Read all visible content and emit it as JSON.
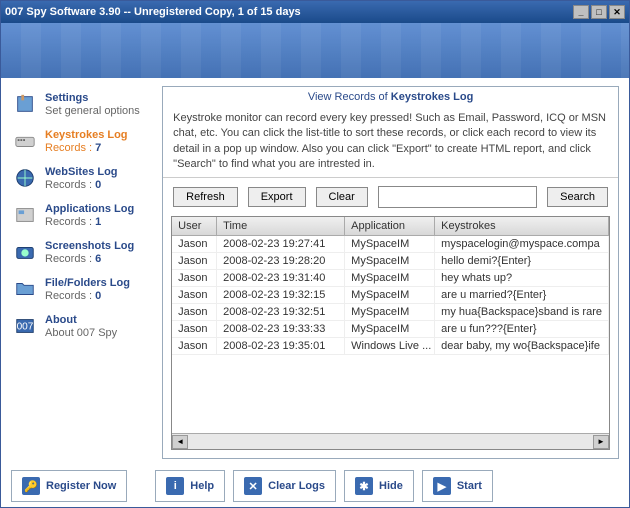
{
  "window": {
    "title": "007 Spy Software 3.90 -- Unregistered Copy, 1 of 15 days"
  },
  "sidebar": {
    "items": [
      {
        "title": "Settings",
        "sub": "Set general options",
        "records": ""
      },
      {
        "title": "Keystrokes Log",
        "sub_prefix": "Records : ",
        "records": "7",
        "active": true
      },
      {
        "title": "WebSites Log",
        "sub_prefix": "Records : ",
        "records": "0"
      },
      {
        "title": "Applications Log",
        "sub_prefix": "Records : ",
        "records": "1"
      },
      {
        "title": "Screenshots Log",
        "sub_prefix": "Records : ",
        "records": "6"
      },
      {
        "title": "File/Folders Log",
        "sub_prefix": "Records : ",
        "records": "0"
      },
      {
        "title": "About",
        "sub": "About 007 Spy",
        "records": ""
      }
    ]
  },
  "panel": {
    "title_prefix": "View Records of ",
    "title_subject": "Keystrokes Log",
    "description": "Keystroke monitor can record every key pressed! Such as Email, Password, ICQ or MSN chat, etc. You can click the list-title to sort these records, or click each record to view its detail in a pop up window. Also you can click \"Export\" to create HTML report, and click \"Search\" to find what you are intrested in.",
    "buttons": {
      "refresh": "Refresh",
      "export": "Export",
      "clear": "Clear",
      "search": "Search"
    },
    "search_value": "",
    "columns": {
      "user": "User",
      "time": "Time",
      "app": "Application",
      "keys": "Keystrokes"
    },
    "rows": [
      {
        "user": "Jason",
        "time": "2008-02-23 19:27:41",
        "app": "MySpaceIM",
        "keys": "myspacelogin@myspace.compa"
      },
      {
        "user": "Jason",
        "time": "2008-02-23 19:28:20",
        "app": "MySpaceIM",
        "keys": "hello demi?{Enter}"
      },
      {
        "user": "Jason",
        "time": "2008-02-23 19:31:40",
        "app": "MySpaceIM",
        "keys": "hey whats up?"
      },
      {
        "user": "Jason",
        "time": "2008-02-23 19:32:15",
        "app": "MySpaceIM",
        "keys": "are u married?{Enter}"
      },
      {
        "user": "Jason",
        "time": "2008-02-23 19:32:51",
        "app": "MySpaceIM",
        "keys": "my hua{Backspace}sband is rare"
      },
      {
        "user": "Jason",
        "time": "2008-02-23 19:33:33",
        "app": "MySpaceIM",
        "keys": "are u fun???{Enter}"
      },
      {
        "user": "Jason",
        "time": "2008-02-23 19:35:01",
        "app": "Windows Live ...",
        "keys": "dear baby, my wo{Backspace}ife"
      }
    ]
  },
  "bottom": {
    "register": "Register Now",
    "help": "Help",
    "clearlogs": "Clear Logs",
    "hide": "Hide",
    "start": "Start"
  },
  "icons": {
    "key": "🔑",
    "help": "i",
    "x": "✕",
    "snow": "✱",
    "play": "▶"
  }
}
